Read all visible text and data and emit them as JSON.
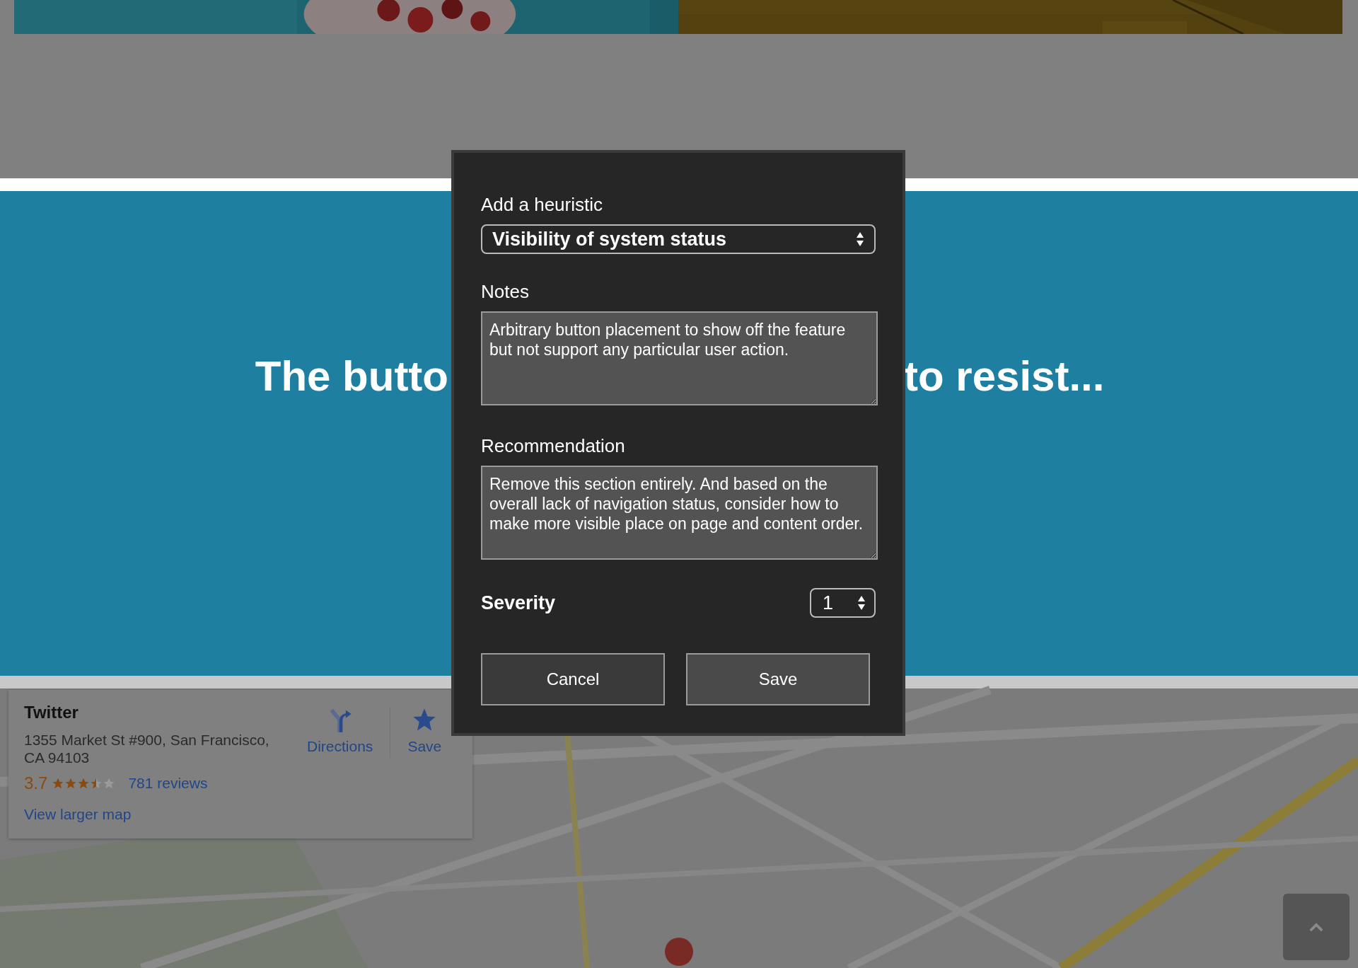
{
  "hero": {
    "heading_left": "The butto",
    "heading_right": "to resist..."
  },
  "dialog": {
    "heuristic_label": "Add a heuristic",
    "heuristic": "Visibility of system status",
    "notes_label": "Notes",
    "notes": "Arbitrary button placement to show off the feature but not support any particular user action.",
    "recommendation_label": "Recommendation",
    "recommendation": "Remove this section entirely. And based on the overall lack of navigation status, consider how to make more visible place on page and content order.",
    "severity_label": "Severity",
    "severity": "1",
    "buttons": [
      {
        "label": "Cancel",
        "kind": "cancel"
      },
      {
        "label": "Save",
        "kind": "save"
      }
    ]
  },
  "map_card": {
    "name": "Twitter",
    "address": "1355 Market St #900, San Francisco, CA 94103",
    "rating": "3.7",
    "stars": 3.5,
    "reviews": "781 reviews",
    "actions": [
      {
        "label": "Directions",
        "kind": "directions"
      },
      {
        "label": "Save",
        "kind": "save"
      }
    ],
    "link": "View larger map"
  }
}
